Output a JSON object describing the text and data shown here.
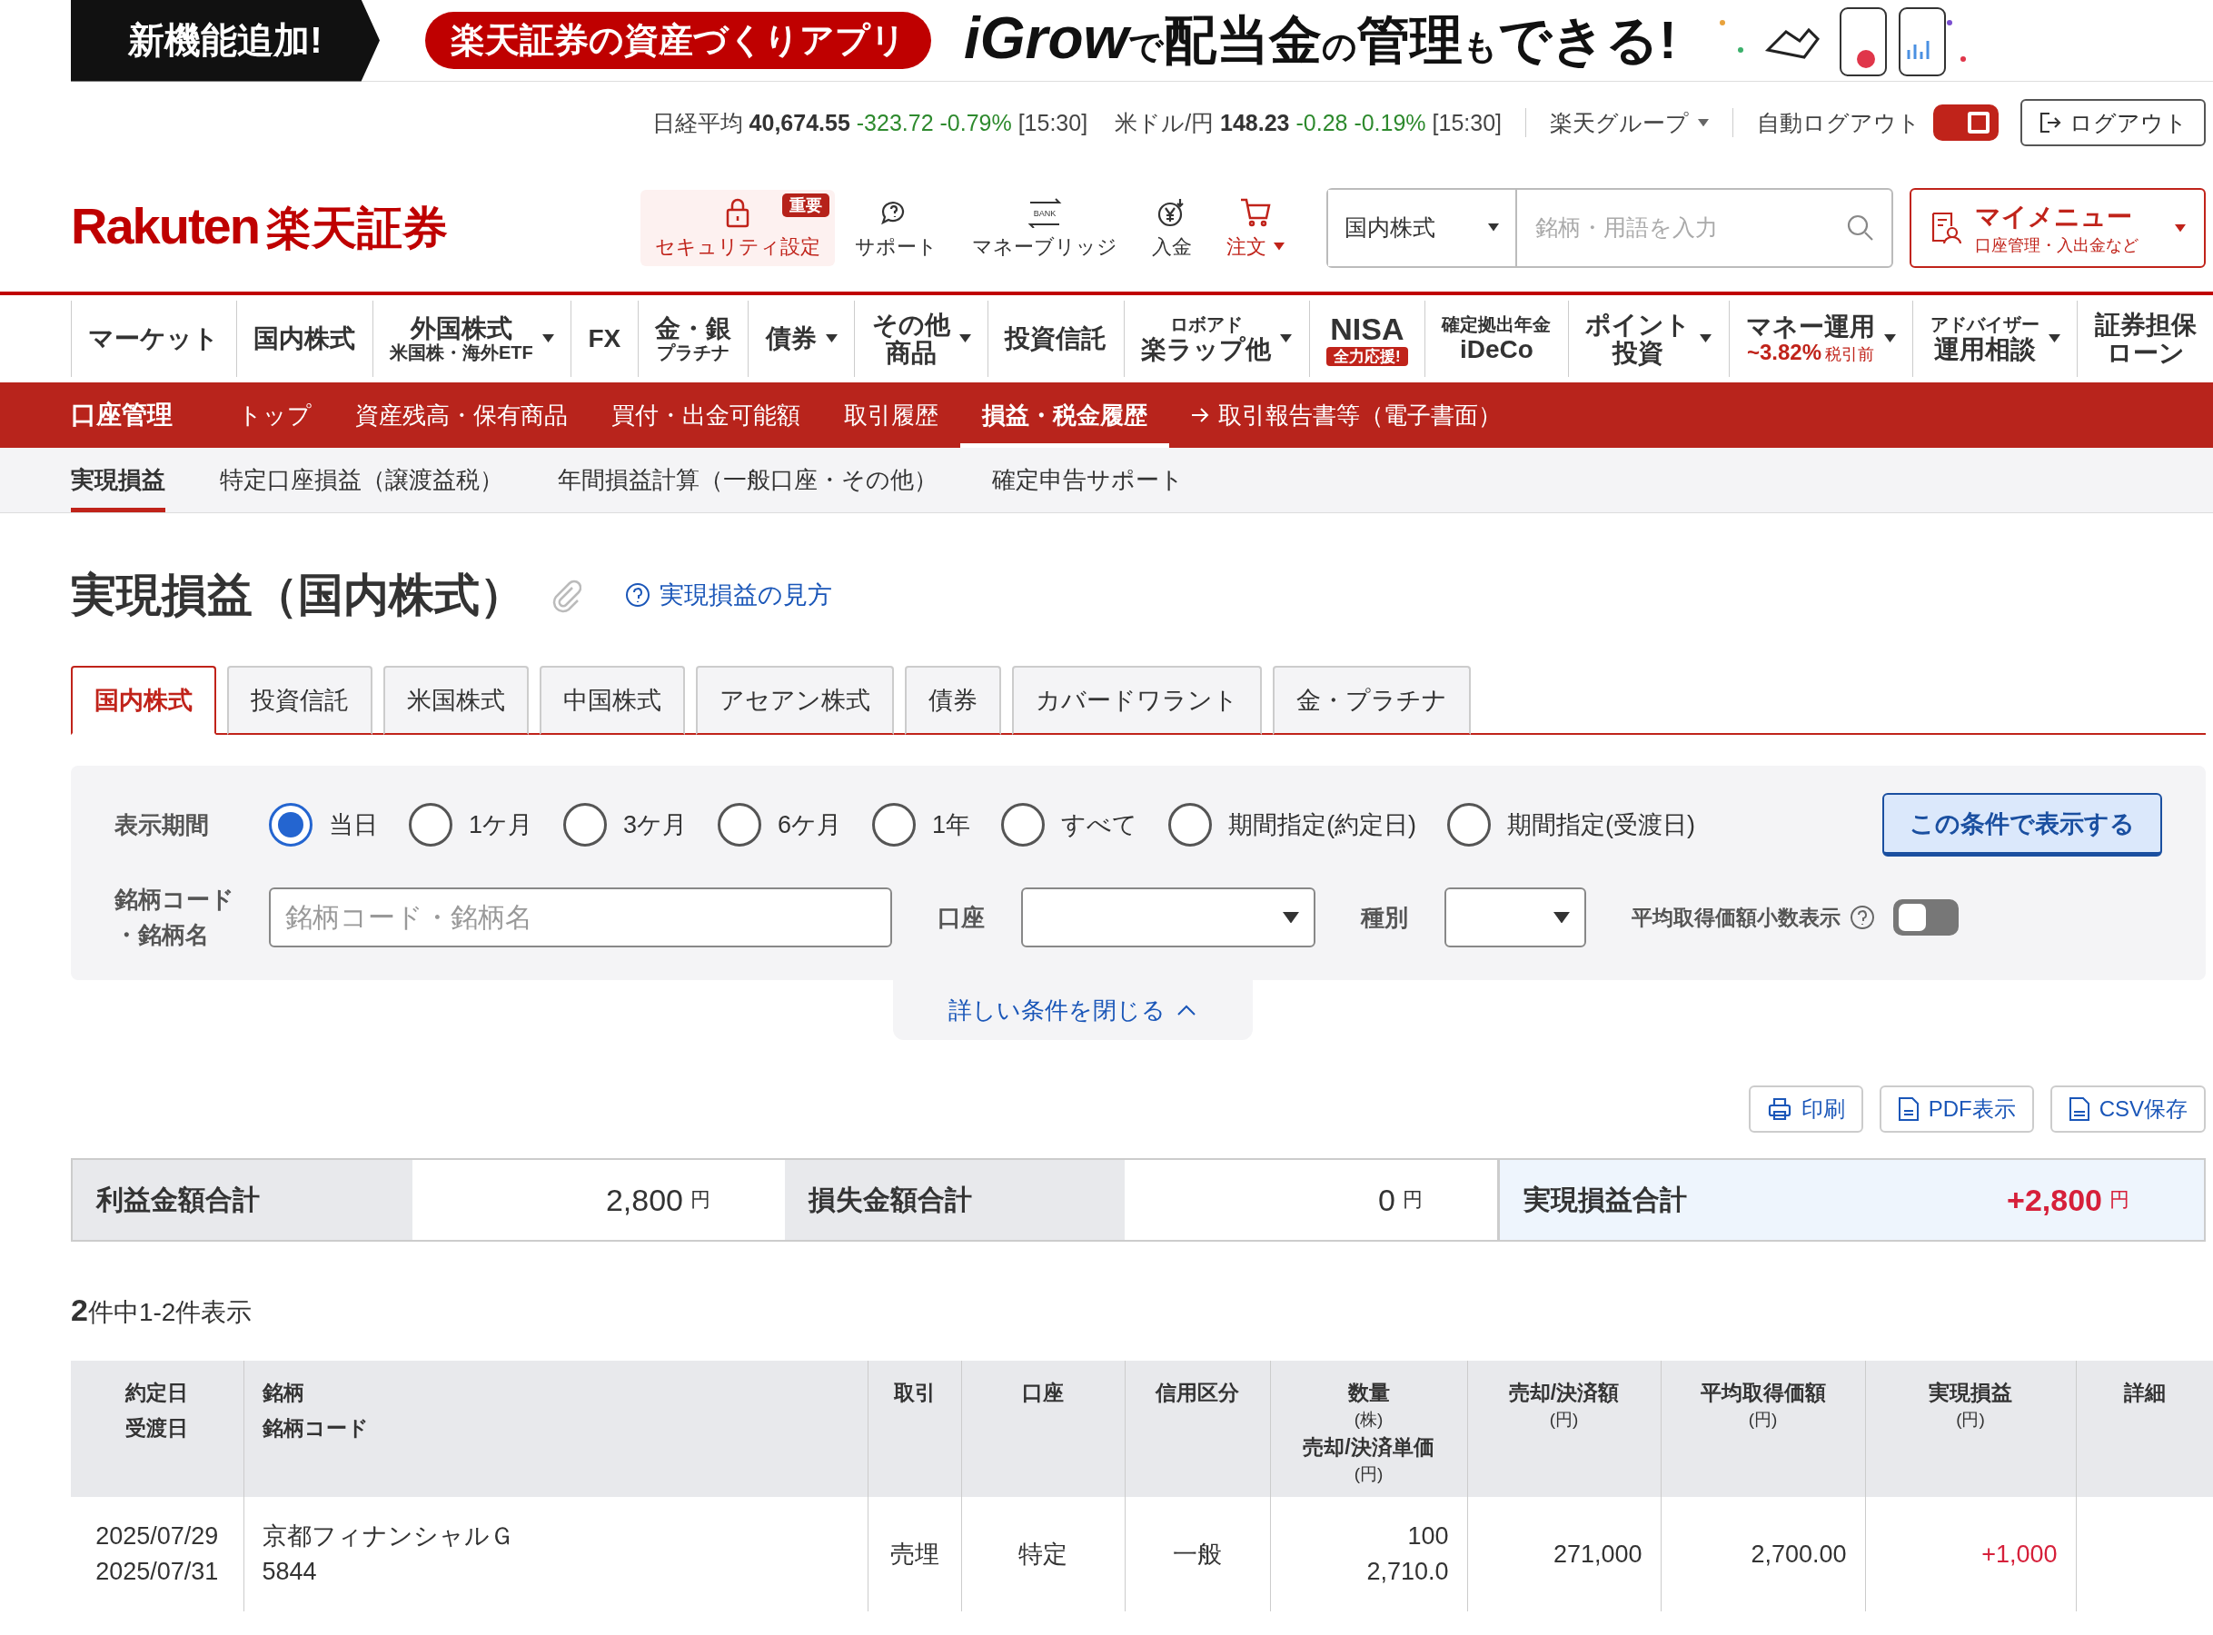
{
  "banner": {
    "label": "新機能追加!",
    "pill": "楽天証券の資産づくりアプリ",
    "headline": [
      {
        "text": "iGrow",
        "kind": "brand"
      },
      {
        "text": "で",
        "kind": "small"
      },
      {
        "text": "配当金",
        "kind": "big"
      },
      {
        "text": "の",
        "kind": "small"
      },
      {
        "text": "管理",
        "kind": "big"
      },
      {
        "text": "も",
        "kind": "small"
      },
      {
        "text": "できる!",
        "kind": "big"
      }
    ]
  },
  "ticker": [
    {
      "name": "日経平均",
      "value": "40,674.55",
      "change": "-323.72 -0.79%",
      "time": "[15:30]"
    },
    {
      "name": "米ドル/円",
      "value": "148.23",
      "change": "-0.28 -0.19%",
      "time": "[15:30]"
    }
  ],
  "group_menu": "楽天グループ",
  "auto_logout": {
    "label": "自動ログアウト",
    "on": true
  },
  "logout": "ログアウト",
  "logo": {
    "latin": "Rakuten",
    "kanji": "楽天証券"
  },
  "tools": [
    {
      "label": "セキュリティ設定",
      "badge": "重要",
      "highlighted": true,
      "caret": false
    },
    {
      "label": "サポート",
      "highlighted": false,
      "caret": false
    },
    {
      "label": "マネーブリッジ",
      "icon_text": "BANK",
      "highlighted": false,
      "caret": false
    },
    {
      "label": "入金",
      "highlighted": false,
      "caret": false
    },
    {
      "label": "注文",
      "highlighted": true,
      "caret": true
    }
  ],
  "search": {
    "category": "国内株式",
    "placeholder": "銘柄・用語を入力"
  },
  "my_menu": {
    "title": "マイメニュー",
    "subtitle": "口座管理・入出金など"
  },
  "nav": [
    {
      "kind": "plain",
      "top": "マーケット",
      "caret": false
    },
    {
      "kind": "plain",
      "top": "国内株式",
      "caret": false
    },
    {
      "kind": "sub",
      "top": "外国株式",
      "bottom": "米国株・海外ETF",
      "caret": true
    },
    {
      "kind": "plain",
      "top": "FX",
      "caret": false
    },
    {
      "kind": "sub",
      "top": "金・銀",
      "bottom": "プラチナ",
      "caret": false
    },
    {
      "kind": "plain",
      "top": "債券",
      "caret": true
    },
    {
      "kind": "two",
      "top": "その他",
      "bottom": "商品",
      "caret": true
    },
    {
      "kind": "plain",
      "top": "投資信託",
      "caret": false
    },
    {
      "kind": "pre",
      "top": "ロボアド",
      "bottom": "楽ラップ他",
      "caret": true
    },
    {
      "kind": "badge",
      "top": "NISA",
      "bottom": "全力応援!",
      "caret": false
    },
    {
      "kind": "pre",
      "top": "確定拠出年金",
      "bottom": "iDeCo",
      "caret": false
    },
    {
      "kind": "two",
      "top": "ポイント",
      "bottom": "投資",
      "caret": true
    },
    {
      "kind": "rate",
      "top": "マネー運用",
      "bottom": "~3.82%",
      "note": "税引前",
      "caret": true
    },
    {
      "kind": "pre",
      "top": "アドバイザー",
      "bottom": "運用相談",
      "caret": true
    },
    {
      "kind": "two",
      "top": "証券担保",
      "bottom": "ローン",
      "caret": false
    }
  ],
  "account_bar": {
    "title": "口座管理",
    "items": [
      {
        "label": "トップ",
        "selected": false,
        "arrow": false
      },
      {
        "label": "資産残高・保有商品",
        "selected": false,
        "arrow": false
      },
      {
        "label": "買付・出金可能額",
        "selected": false,
        "arrow": false
      },
      {
        "label": "取引履歴",
        "selected": false,
        "arrow": false
      },
      {
        "label": "損益・税金履歴",
        "selected": true,
        "arrow": false
      },
      {
        "label": "取引報告書等（電子書面）",
        "selected": false,
        "arrow": true
      }
    ]
  },
  "sub_tabs": [
    {
      "label": "実現損益",
      "selected": true
    },
    {
      "label": "特定口座損益（譲渡益税）",
      "selected": false
    },
    {
      "label": "年間損益計算（一般口座・その他）",
      "selected": false
    },
    {
      "label": "確定申告サポート",
      "selected": false
    }
  ],
  "page_title": "実現損益（国内株式）",
  "help_link": "実現損益の見方",
  "market_tabs": [
    {
      "label": "国内株式",
      "selected": true
    },
    {
      "label": "投資信託",
      "selected": false
    },
    {
      "label": "米国株式",
      "selected": false
    },
    {
      "label": "中国株式",
      "selected": false
    },
    {
      "label": "アセアン株式",
      "selected": false
    },
    {
      "label": "債券",
      "selected": false
    },
    {
      "label": "カバードワラント",
      "selected": false
    },
    {
      "label": "金・プラチナ",
      "selected": false
    }
  ],
  "filter": {
    "period_label": "表示期間",
    "periods": [
      {
        "label": "当日",
        "selected": true
      },
      {
        "label": "1ケ月",
        "selected": false
      },
      {
        "label": "3ケ月",
        "selected": false
      },
      {
        "label": "6ケ月",
        "selected": false
      },
      {
        "label": "1年",
        "selected": false
      },
      {
        "label": "すべて",
        "selected": false
      },
      {
        "label": "期間指定(約定日)",
        "selected": false
      },
      {
        "label": "期間指定(受渡日)",
        "selected": false
      }
    ],
    "submit": "この条件で表示する",
    "code_label": [
      "銘柄コード",
      "・銘柄名"
    ],
    "code_placeholder": "銘柄コード・銘柄名",
    "account_label": "口座",
    "type_label": "種別",
    "decimal_label": "平均取得価額小数表示",
    "decimal_on": false,
    "collapse": "詳しい条件を閉じる"
  },
  "actions": [
    "印刷",
    "PDF表示",
    "CSV保存"
  ],
  "summary": [
    {
      "label": "利益金額合計",
      "value": "2,800",
      "unit": "円",
      "highlighted": false
    },
    {
      "label": "損失金額合計",
      "value": "0",
      "unit": "円",
      "highlighted": false
    },
    {
      "label": "実現損益合計",
      "value": "+2,800",
      "unit": "円",
      "highlighted": true
    }
  ],
  "count": "**2**件中1-2件表示",
  "table": {
    "columns": [
      {
        "lines": [
          {
            "text": "約定日",
            "kind": "main"
          },
          {
            "text": "受渡日",
            "kind": "main"
          }
        ]
      },
      {
        "lines": [
          {
            "text": "銘柄",
            "kind": "main"
          },
          {
            "text": "銘柄コード",
            "kind": "main"
          }
        ]
      },
      {
        "lines": [
          {
            "text": "取引",
            "kind": "main"
          }
        ]
      },
      {
        "lines": [
          {
            "text": "口座",
            "kind": "main"
          }
        ]
      },
      {
        "lines": [
          {
            "text": "信用区分",
            "kind": "main"
          }
        ]
      },
      {
        "lines": [
          {
            "text": "数量",
            "kind": "main"
          },
          {
            "text": "(株)",
            "kind": "unit"
          },
          {
            "text": "売却/決済単価",
            "kind": "main"
          },
          {
            "text": "(円)",
            "kind": "unit"
          }
        ]
      },
      {
        "lines": [
          {
            "text": "売却/決済額",
            "kind": "main"
          },
          {
            "text": "(円)",
            "kind": "unit"
          }
        ]
      },
      {
        "lines": [
          {
            "text": "平均取得価額",
            "kind": "main"
          },
          {
            "text": "(円)",
            "kind": "unit"
          }
        ]
      },
      {
        "lines": [
          {
            "text": "実現損益",
            "kind": "main"
          },
          {
            "text": "(円)",
            "kind": "unit"
          }
        ]
      },
      {
        "lines": [
          {
            "text": "詳細",
            "kind": "main"
          }
        ]
      }
    ],
    "rows": [
      {
        "cells": [
          [
            "2025/07/29",
            "2025/07/31"
          ],
          [
            "京都フィナンシャルＧ",
            "5844"
          ],
          [
            "売埋"
          ],
          [
            "特定"
          ],
          [
            "一般"
          ],
          [
            "100",
            "2,710.0"
          ],
          [
            "271,000"
          ],
          [
            "2,700.00"
          ],
          [
            "+1,000"
          ],
          []
        ],
        "gain": true
      }
    ]
  }
}
